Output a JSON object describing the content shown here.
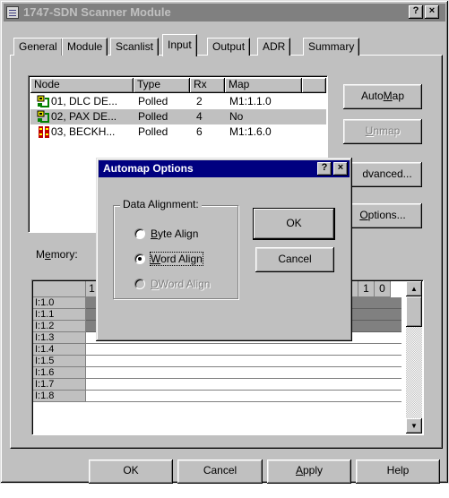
{
  "window": {
    "title": "1747-SDN Scanner Module",
    "help_btn": "?",
    "close_btn": "×"
  },
  "tabs": [
    "General",
    "Module",
    "Scanlist",
    "Input",
    "Output",
    "ADR",
    "Summary"
  ],
  "active_tab": "Input",
  "node_list": {
    "columns": [
      "Node",
      "Type",
      "Rx",
      "Map"
    ],
    "rows": [
      {
        "node": "01, DLC DE...",
        "type": "Polled",
        "rx": "2",
        "map": "M1:1.1.0"
      },
      {
        "node": "02, PAX DE...",
        "type": "Polled",
        "rx": "4",
        "map": "No"
      },
      {
        "node": "03, BECKH...",
        "type": "Polled",
        "rx": "6",
        "map": "M1:1.6.0"
      }
    ]
  },
  "side_buttons": {
    "automap_pre": "Auto",
    "automap_u": "M",
    "automap_post": "ap",
    "unmap_u": "U",
    "unmap_post": "nmap",
    "advanced": "dvanced...",
    "options_u": "O",
    "options_post": "ptions..."
  },
  "memory": {
    "label_pre": "M",
    "label_u": "e",
    "label_post": "mory:",
    "col_headers_left": [
      "1"
    ],
    "col_headers_right": [
      "1",
      "0"
    ],
    "rows": [
      "I:1.0",
      "I:1.1",
      "I:1.2",
      "I:1.3",
      "I:1.4",
      "I:1.5",
      "I:1.6",
      "I:1.7",
      "I:1.8"
    ]
  },
  "dialog": {
    "title": "Automap Options",
    "help_btn": "?",
    "close_btn": "×",
    "group_label": "Data Alignment:",
    "radios": [
      {
        "u": "B",
        "rest": "yte Align",
        "checked": false,
        "disabled": false
      },
      {
        "u": "W",
        "rest": "ord Align",
        "checked": true,
        "disabled": false
      },
      {
        "u": "D",
        "rest": "Word Align",
        "checked": false,
        "disabled": true
      }
    ],
    "ok": "OK",
    "cancel": "Cancel"
  },
  "footer": {
    "ok": "OK",
    "cancel": "Cancel",
    "apply_u": "A",
    "apply_post": "pply",
    "help": "Help"
  }
}
